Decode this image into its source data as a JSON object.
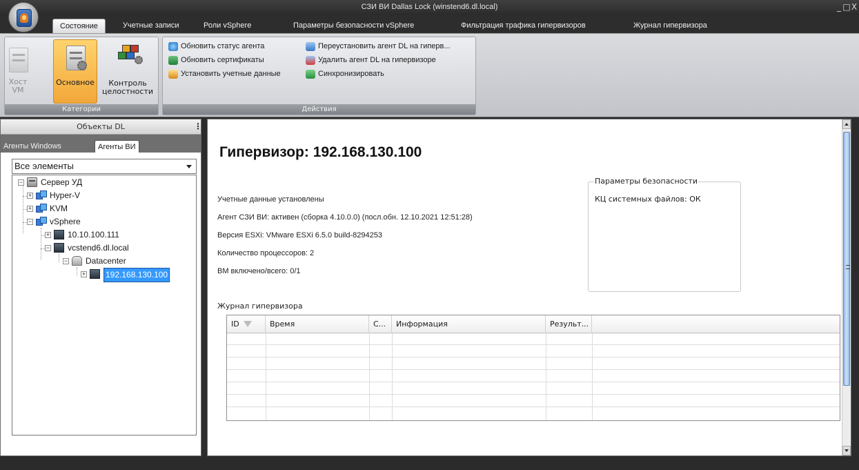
{
  "window": {
    "title": "СЗИ ВИ Dallas Lock (winstend6.dl.local)",
    "controls": [
      "_",
      "□",
      "X"
    ]
  },
  "tabs": [
    {
      "label": "Состояние",
      "active": true
    },
    {
      "label": "Учетные записи"
    },
    {
      "label": "Роли vSphere"
    },
    {
      "label": "Параметры безопасности vSphere"
    },
    {
      "label": "Фильтрация трафика гипервизоров"
    },
    {
      "label": "Журнал гипервизора"
    }
  ],
  "ribbon": {
    "categories": {
      "label": "Категории",
      "buttons": [
        {
          "label_line1": "Хост",
          "label_line2": "VM",
          "state": "disabled"
        },
        {
          "label_line1": "Основное",
          "label_line2": "",
          "state": "selected"
        },
        {
          "label_line1": "Контроль",
          "label_line2": "целостности",
          "state": "normal"
        }
      ]
    },
    "actions": {
      "label": "Действия",
      "items": [
        {
          "label": "Обновить статус агента",
          "icon": "refresh-status-icon"
        },
        {
          "label": "Обновить сертификаты",
          "icon": "certificate-icon"
        },
        {
          "label": "Установить учетные данные",
          "icon": "credentials-icon"
        },
        {
          "label": "Переустановить агент DL на гиперв...",
          "icon": "reinstall-agent-icon"
        },
        {
          "label": "Удалить агент DL на гипервизоре",
          "icon": "remove-agent-icon"
        },
        {
          "label": "Синхронизировать",
          "icon": "sync-icon"
        }
      ]
    }
  },
  "left_panel": {
    "header": "Объекты DL",
    "tabs": [
      {
        "label": "Агенты Windows"
      },
      {
        "label": "Агенты ВИ",
        "active": true
      }
    ],
    "filter_value": "Все элементы",
    "tree": [
      {
        "label": "Сервер УД",
        "icon": "server-icon",
        "expander": "−"
      },
      {
        "label": "Hyper-V",
        "icon": "network-icon",
        "expander": "+"
      },
      {
        "label": "KVM",
        "icon": "network-icon",
        "expander": "+"
      },
      {
        "label": "vSphere",
        "icon": "network-icon",
        "expander": "−"
      },
      {
        "label": "10.10.100.111",
        "icon": "host-icon",
        "expander": "+"
      },
      {
        "label": "vcstend6.dl.local",
        "icon": "host-icon",
        "expander": "−"
      },
      {
        "label": "Datacenter",
        "icon": "datacenter-icon",
        "expander": "−"
      },
      {
        "label": "192.168.130.100",
        "icon": "host-icon",
        "expander": "+",
        "selected": true
      }
    ]
  },
  "content": {
    "title": "Гипервизор: 192.168.130.100",
    "info": [
      "Учетные данные установлены",
      "Агент СЗИ ВИ: активен (сборка 4.10.0.0) (посл.обн. 12.10.2021 12:51:28)",
      "Версия ESXi: VMware ESXi 6.5.0 build-8294253",
      "Количество процессоров: 2",
      "ВМ включено/всего: 0/1"
    ],
    "security": {
      "legend": "Параметры безопасности",
      "items": [
        "КЦ системных файлов: ОК"
      ]
    },
    "log": {
      "label": "Журнал гипервизора",
      "columns": [
        "ID",
        "Время",
        "С...",
        "Информация",
        "Результ..."
      ],
      "rows": []
    }
  }
}
